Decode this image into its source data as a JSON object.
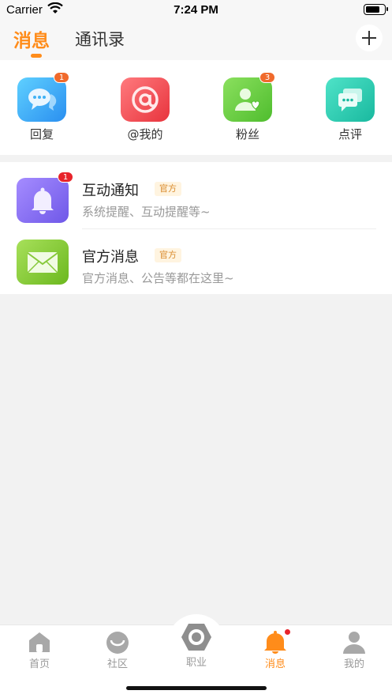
{
  "status_bar": {
    "carrier": "Carrier",
    "time": "7:24 PM"
  },
  "header": {
    "tabs": [
      {
        "label": "消息",
        "active": true
      },
      {
        "label": "通讯录",
        "active": false
      }
    ],
    "add_icon": "plus-icon"
  },
  "quick_actions": [
    {
      "label": "回复",
      "icon": "chat-bubbles-icon",
      "badge": "1",
      "color": "#3fb2f5"
    },
    {
      "label": "@我的",
      "icon": "at-icon",
      "badge": "",
      "color": "#f04e55"
    },
    {
      "label": "粉丝",
      "icon": "fan-heart-icon",
      "badge": "3",
      "color": "#6fd04a"
    },
    {
      "label": "点评",
      "icon": "comment-icon",
      "badge": "",
      "color": "#2fcfb6"
    }
  ],
  "messages": [
    {
      "title": "互动通知",
      "tag": "官方",
      "subtitle": "系统提醒、互动提醒等~",
      "icon": "bell-icon",
      "badge": "1",
      "color": "#8a72ef"
    },
    {
      "title": "官方消息",
      "tag": "官方",
      "subtitle": "官方消息、公告等都在这里~",
      "icon": "envelope-icon",
      "badge": "",
      "color": "#86c93a"
    }
  ],
  "tab_bar": {
    "items": [
      {
        "label": "首页",
        "icon": "home-icon",
        "active": false
      },
      {
        "label": "社区",
        "icon": "community-icon",
        "active": false
      },
      {
        "label": "职业",
        "icon": "career-hex-icon",
        "active": false
      },
      {
        "label": "消息",
        "icon": "bell-icon",
        "active": true
      },
      {
        "label": "我的",
        "icon": "profile-icon",
        "active": false
      }
    ]
  },
  "colors": {
    "accent": "#ff8c1a",
    "badge_red": "#e8242b",
    "badge_orange": "#f06a2c"
  }
}
